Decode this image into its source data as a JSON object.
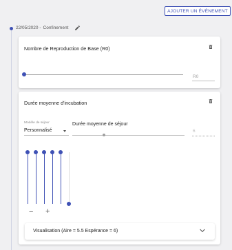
{
  "header": {
    "add_event_button": "AJOUTER UN ÉVÈNEMENT",
    "event_date": "22/05/2020 -",
    "event_title": "Confinement"
  },
  "card_r0": {
    "title": "Nombre de Reproduction de Base (R0)",
    "input_label": "R0",
    "slider_value": 0
  },
  "card_incubation": {
    "title": "Durée moyenne d'incubation",
    "select_label": "Modèle de séjour",
    "select_value": "Personnalisé",
    "stay_label": "Durée moyenne de séjour",
    "stay_value": "6",
    "minus_label": "−",
    "plus_label": "+",
    "accordion_label": "Visualisation (Aire = 5.5 Espérance = 6)"
  },
  "colors": {
    "accent": "#3f51b5",
    "background": "#f0f0f2"
  },
  "icons": {
    "edit": "pencil-icon",
    "delete": "trash-icon",
    "expand": "chevron-down-icon"
  }
}
